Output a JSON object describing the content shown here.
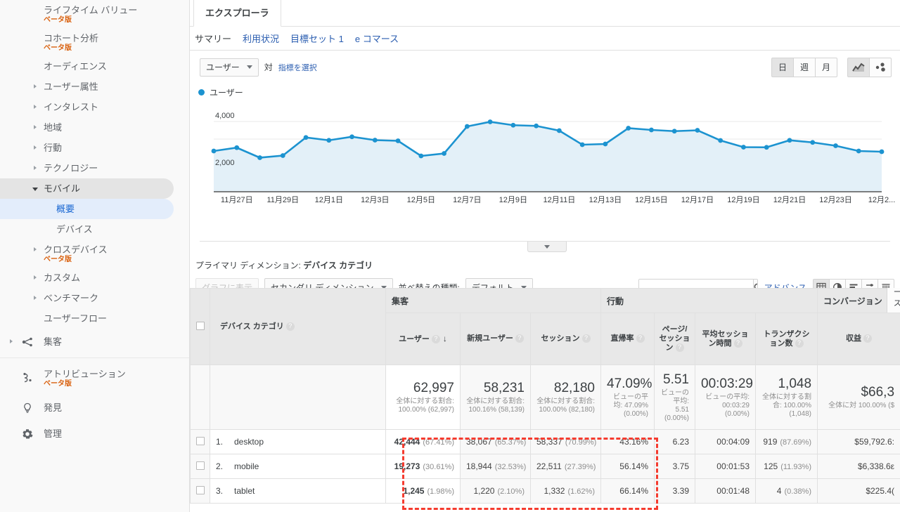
{
  "sidebar": {
    "items": [
      {
        "id": "lifetime-value",
        "label": "ライフタイム バリュー",
        "badge": "ベータ版",
        "level": 1,
        "arrow": "none"
      },
      {
        "id": "cohort-analysis",
        "label": "コホート分析",
        "badge": "ベータ版",
        "level": 1,
        "arrow": "none"
      },
      {
        "id": "audience",
        "label": "オーディエンス",
        "badge": "",
        "level": 1,
        "arrow": "none"
      },
      {
        "id": "user-attributes",
        "label": "ユーザー属性",
        "badge": "",
        "level": 1,
        "arrow": "closed"
      },
      {
        "id": "interests",
        "label": "インタレスト",
        "badge": "",
        "level": 1,
        "arrow": "closed"
      },
      {
        "id": "geo",
        "label": "地域",
        "badge": "",
        "level": 1,
        "arrow": "closed"
      },
      {
        "id": "behavior",
        "label": "行動",
        "badge": "",
        "level": 1,
        "arrow": "closed"
      },
      {
        "id": "technology",
        "label": "テクノロジー",
        "badge": "",
        "level": 1,
        "arrow": "closed"
      },
      {
        "id": "mobile",
        "label": "モバイル",
        "badge": "",
        "level": 1,
        "arrow": "open",
        "state": "group"
      },
      {
        "id": "mobile-overview",
        "label": "概要",
        "badge": "",
        "level": 2,
        "arrow": "none",
        "state": "selected"
      },
      {
        "id": "mobile-devices",
        "label": "デバイス",
        "badge": "",
        "level": 2,
        "arrow": "none"
      },
      {
        "id": "cross-device",
        "label": "クロスデバイス",
        "badge": "ベータ版",
        "level": 1,
        "arrow": "closed"
      },
      {
        "id": "custom",
        "label": "カスタム",
        "badge": "",
        "level": 1,
        "arrow": "closed"
      },
      {
        "id": "benchmark",
        "label": "ベンチマーク",
        "badge": "",
        "level": 1,
        "arrow": "closed"
      },
      {
        "id": "user-flow",
        "label": "ユーザーフロー",
        "badge": "",
        "level": 1,
        "arrow": "none"
      }
    ],
    "top_items": [
      {
        "id": "acquisition",
        "label": "集客",
        "icon": "acquisition-icon",
        "badge": "",
        "arrow": "closed"
      },
      {
        "id": "attribution",
        "label": "アトリビューション",
        "icon": "attribution-icon",
        "badge": "ベータ版",
        "arrow": "none"
      },
      {
        "id": "discover",
        "label": "発見",
        "icon": "lightbulb-icon",
        "badge": "",
        "arrow": "none"
      },
      {
        "id": "admin",
        "label": "管理",
        "icon": "gear-icon",
        "badge": "",
        "arrow": "none"
      }
    ]
  },
  "tabs": {
    "main_tab": "エクスプローラ",
    "subtabs": [
      {
        "id": "summary",
        "label": "サマリー",
        "active": true
      },
      {
        "id": "usage",
        "label": "利用状況",
        "active": false
      },
      {
        "id": "goal-set-1",
        "label": "目標セット 1",
        "active": false
      },
      {
        "id": "ecommerce",
        "label": "e コマース",
        "active": false
      }
    ]
  },
  "metric_row": {
    "primary_metric": "ユーザー",
    "vs_label": "対",
    "select_metric_link": "指標を選択",
    "granularity": [
      {
        "id": "day",
        "label": "日",
        "active": true
      },
      {
        "id": "week",
        "label": "週",
        "active": false
      },
      {
        "id": "month",
        "label": "月",
        "active": false
      }
    ],
    "chart_types": [
      {
        "id": "line-chart",
        "label": "line-chart-icon",
        "active": true
      },
      {
        "id": "motion-chart",
        "label": "motion-chart-icon",
        "active": false
      }
    ]
  },
  "chart_data": {
    "type": "line",
    "title": "",
    "legend": [
      "ユーザー"
    ],
    "legend_position": "top-left",
    "series_color": "#1c93d0",
    "fill_color": "#e3f0f8",
    "xlabel": "",
    "ylabel": "",
    "ylim": [
      0,
      4800
    ],
    "yticks": [
      2000,
      4000
    ],
    "ytick_labels": [
      "2,000",
      "4,000"
    ],
    "grid": true,
    "x_tick_labels": [
      "11月27日",
      "11月29日",
      "12月1日",
      "12月3日",
      "12月5日",
      "12月7日",
      "12月9日",
      "12月11日",
      "12月13日",
      "12月15日",
      "12月17日",
      "12月19日",
      "12月21日",
      "12月23日",
      "12月2..."
    ],
    "x": [
      "11月26日",
      "11月27日",
      "11月28日",
      "11月29日",
      "11月30日",
      "12月1日",
      "12月2日",
      "12月3日",
      "12月4日",
      "12月5日",
      "12月6日",
      "12月7日",
      "12月8日",
      "12月9日",
      "12月10日",
      "12月11日",
      "12月12日",
      "12月13日",
      "12月14日",
      "12月15日",
      "12月16日",
      "12月17日",
      "12月18日",
      "12月19日",
      "12月20日",
      "12月21日",
      "12月22日",
      "12月23日",
      "12月24日"
    ],
    "values": [
      2320,
      2510,
      1940,
      2060,
      3090,
      2930,
      3130,
      2940,
      2900,
      2040,
      2180,
      3720,
      3980,
      3790,
      3750,
      3480,
      2680,
      2720,
      3620,
      3520,
      3450,
      3500,
      2920,
      2540,
      2530,
      2930,
      2810,
      2620,
      2320,
      2280
    ]
  },
  "table_controls": {
    "primary_dimension_label": "プライマリ ディメンション:",
    "primary_dimension_value": "デバイス カテゴリ",
    "plot_rows_label": "グラフに表示",
    "secondary_dimension_label": "セカンダリ ディメンション",
    "sort_type_label": "並べ替えの種類:",
    "sort_type_value": "デフォルト",
    "search_value": "",
    "search_placeholder": "",
    "advanced_label": "アドバンス",
    "view_modes": [
      {
        "id": "table-view",
        "icon": "table-icon",
        "active": true
      },
      {
        "id": "pie-view",
        "icon": "pie-chart-icon",
        "active": false
      },
      {
        "id": "bar-view",
        "icon": "bar-chart-icon",
        "active": false
      },
      {
        "id": "performance-view",
        "icon": "comparison-icon",
        "active": false
      },
      {
        "id": "pivot-view",
        "icon": "pivot-icon",
        "active": false
      }
    ]
  },
  "table": {
    "groups": [
      {
        "id": "acquisition-group",
        "label": "集客",
        "span": 3
      },
      {
        "id": "behavior-group",
        "label": "行動",
        "span": 4
      },
      {
        "id": "conversion-group",
        "label": "コンバージョン",
        "span": 1,
        "tab": "e コマース"
      }
    ],
    "dimension_header": "デバイス カテゴリ",
    "columns": [
      {
        "id": "users",
        "label": "ユーザー",
        "sorted": true
      },
      {
        "id": "new-users",
        "label": "新規ユーザー",
        "sorted": false
      },
      {
        "id": "sessions",
        "label": "セッション",
        "sorted": false
      },
      {
        "id": "bounce-rate",
        "label": "直帰率",
        "sorted": false
      },
      {
        "id": "pages-per-session",
        "label": "ページ/セッション",
        "sorted": false
      },
      {
        "id": "avg-session-duration",
        "label": "平均セッション時間",
        "sorted": false
      },
      {
        "id": "transactions",
        "label": "トランザクション数",
        "sorted": false
      },
      {
        "id": "revenue",
        "label": "収益",
        "sorted": false
      }
    ],
    "totals": [
      {
        "value": "62,997",
        "sub": "全体に対する割合: 100.00% (62,997)"
      },
      {
        "value": "58,231",
        "sub": "全体に対する割合: 100.16% (58,139)"
      },
      {
        "value": "82,180",
        "sub": "全体に対する割合: 100.00% (82,180)"
      },
      {
        "value": "47.09%",
        "sub": "ビューの平均: 47.09% (0.00%)"
      },
      {
        "value": "5.51",
        "sub": "ビューの平均: 5.51 (0.00%)"
      },
      {
        "value": "00:03:29",
        "sub": "ビューの平均: 00:03:29 (0.00%)"
      },
      {
        "value": "1,048",
        "sub": "全体に対する割合: 100.00% (1,048)"
      },
      {
        "value": "$66,3",
        "sub": "全体に対 100.00% ($"
      }
    ],
    "rows": [
      {
        "index": "1.",
        "name": "desktop",
        "users": "42,444",
        "users_pct": "(67.41%)",
        "new_users": "38,067",
        "new_users_pct": "(65.37%)",
        "sessions": "58,337",
        "sessions_pct": "(70.99%)",
        "bounce_rate": "43.16%",
        "pages_per_session": "6.23",
        "avg_session_duration": "00:04:09",
        "transactions": "919",
        "transactions_pct": "(87.69%)",
        "revenue": "$59,792.6:"
      },
      {
        "index": "2.",
        "name": "mobile",
        "users": "19,273",
        "users_pct": "(30.61%)",
        "new_users": "18,944",
        "new_users_pct": "(32.53%)",
        "sessions": "22,511",
        "sessions_pct": "(27.39%)",
        "bounce_rate": "56.14%",
        "pages_per_session": "3.75",
        "avg_session_duration": "00:01:53",
        "transactions": "125",
        "transactions_pct": "(11.93%)",
        "revenue": "$6,338.6ε"
      },
      {
        "index": "3.",
        "name": "tablet",
        "users": "1,245",
        "users_pct": "(1.98%)",
        "new_users": "1,220",
        "new_users_pct": "(2.10%)",
        "sessions": "1,332",
        "sessions_pct": "(1.62%)",
        "bounce_rate": "66.14%",
        "pages_per_session": "3.39",
        "avg_session_duration": "00:01:48",
        "transactions": "4",
        "transactions_pct": "(0.38%)",
        "revenue": "$225.4("
      }
    ]
  },
  "highlight": {
    "color": "#f53b2f"
  }
}
